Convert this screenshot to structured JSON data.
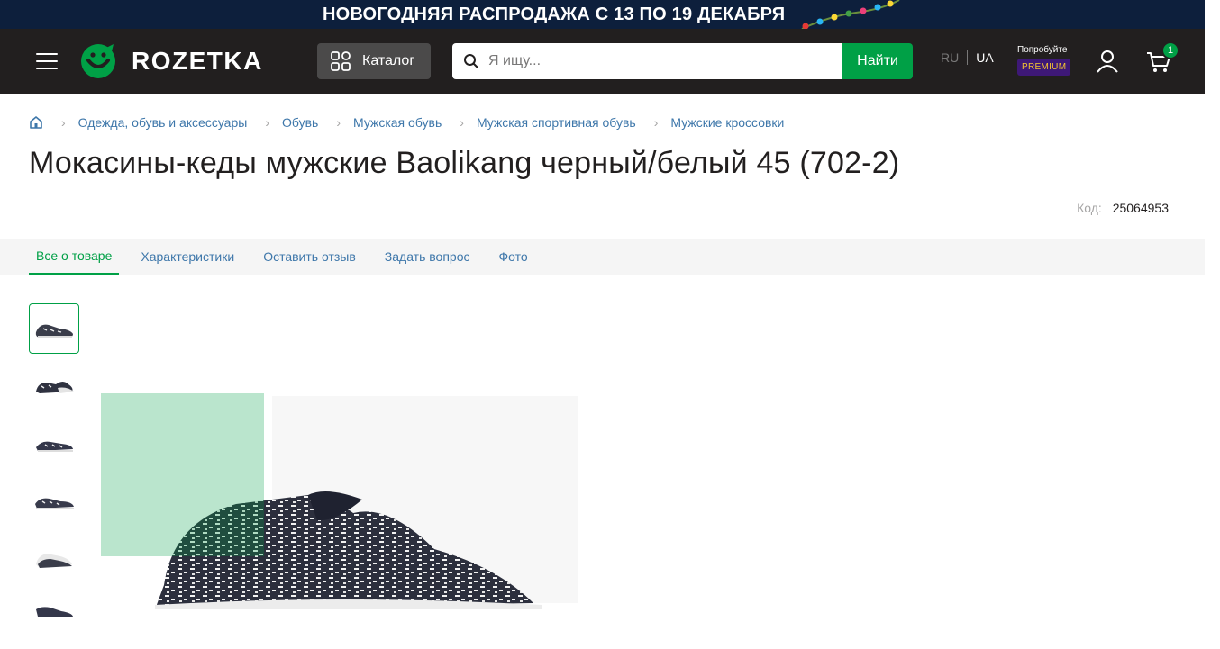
{
  "promo": {
    "text": "НОВОГОДНЯЯ РАСПРОДАЖА С 13 ПО 19 ДЕКАБРЯ"
  },
  "header": {
    "logo_text": "ROZETKA",
    "catalog_label": "Каталог",
    "search_placeholder": "Я ищу...",
    "search_button": "Найти",
    "lang_ru": "RU",
    "lang_ua": "UA",
    "premium_try": "Попробуйте",
    "premium_badge": "PREMIUM",
    "cart_count": "1",
    "icons": [
      "menu-icon",
      "logo-icon",
      "catalog-icon",
      "search-icon",
      "user-icon",
      "cart-icon"
    ]
  },
  "breadcrumbs": [
    "Одежда, обувь и аксессуары",
    "Обувь",
    "Мужская обувь",
    "Мужская спортивная обувь",
    "Мужские кроссовки"
  ],
  "product": {
    "title": "Мокасины-кеды мужские Baolikang черный/белый 45 (702-2)",
    "code_label": "Код:",
    "code_value": "25064953"
  },
  "tabs": [
    "Все о товаре",
    "Характеристики",
    "Оставить отзыв",
    "Задать вопрос",
    "Фото"
  ],
  "colors": {
    "brand_green": "#00a046",
    "header_bg": "#221f1f",
    "link_blue": "#3e77aa"
  }
}
